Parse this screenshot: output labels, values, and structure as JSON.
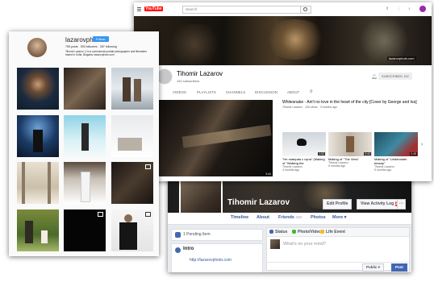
{
  "facebook": {
    "name": "Tihomir Lazarov",
    "edit_profile": "Edit Profile",
    "view_activity": "View Activity Log",
    "activity_count": "2",
    "more_btn": "···",
    "tabs": {
      "timeline": "Timeline",
      "about": "About",
      "friends": "Friends",
      "friends_count": "319",
      "photos": "Photos",
      "more": "More ▾"
    },
    "pending": "1 Pending Item",
    "intro": "Intro",
    "website": "http://lazarovphoto.com",
    "composer": {
      "status": "Status",
      "photo_video": "Photo/Video",
      "life_event": "Life Event",
      "placeholder": "What's on your mind?",
      "privacy": "Public ▾",
      "post": "Post"
    }
  },
  "youtube": {
    "logo": "YouTube",
    "search_placeholder": "Search",
    "banner_badge": "lazarovphoto.com",
    "channel_name": "Tihomir Lazarov",
    "subscribers": "152 subscribers",
    "subscribe": "SUBSCRIBED",
    "subscribe_count": "152",
    "tabs": [
      "VIDEOS",
      "PLAYLISTS",
      "CHANNELS",
      "DISCUSSION",
      "ABOUT"
    ],
    "featured": {
      "title": "Whitesnake - Ain't no love in the heart of the city [Cover by George and Iva]",
      "meta": "Tihomir Lazarov · 126 views · 3 months ago",
      "duration": "3:44"
    },
    "videos": [
      {
        "title": "\"Не поверва с луна\" (Making of \"Walking the",
        "meta": "Tihomir Lazarov",
        "meta2": "4 months ago",
        "duration": "1:02"
      },
      {
        "title": "Making of \"The View\"",
        "meta": "Tihomir Lazarov",
        "meta2": "5 months ago",
        "duration": "0:44"
      },
      {
        "title": "Making of \"Underwater beauty\"",
        "meta": "Tihomir Lazarov",
        "meta2": "5 months ago",
        "duration": "0:45"
      }
    ]
  },
  "instagram": {
    "username": "lazarovphoto",
    "follow": "Follow",
    "stats": "795 posts   393 followers   287 following",
    "bio": "Tihomir Lazarov | I'm a commercial portrait photographer and filmmaker based in Sofia, Bulgaria. lazarovphoto.com"
  },
  "colors": {
    "fb_blue": "#4267b2",
    "yt_red": "#ff0000",
    "ig_blue": "#3897f0"
  }
}
